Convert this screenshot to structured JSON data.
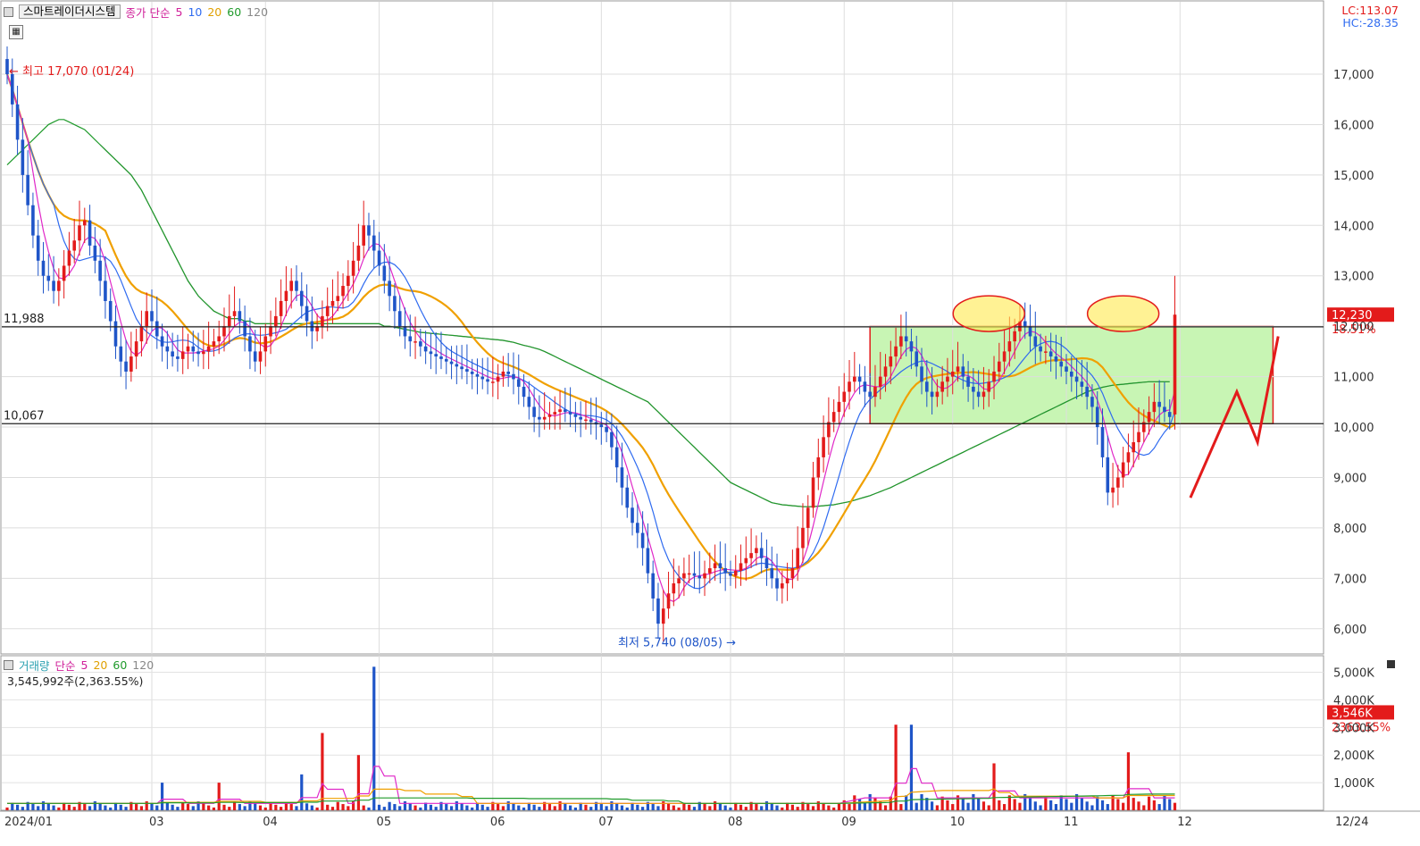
{
  "title": "스마트레이더시스템",
  "price_legend": {
    "label": "종가 단순",
    "periods": [
      "5",
      "10",
      "20",
      "60",
      "120"
    ]
  },
  "lc": "LC:113.07",
  "hc": "HC:-28.35",
  "high_annotation": "최고 17,070 (01/24)",
  "low_annotation": "최저 5,740 (08/05)",
  "levels": [
    {
      "value": 11988,
      "label": "11,988"
    },
    {
      "value": 10067,
      "label": "10,067"
    }
  ],
  "last_price": {
    "value": 12230,
    "label": "12,230",
    "change": "18.51%"
  },
  "volume_legend": {
    "label": "거래량",
    "ma_label": "단순",
    "periods": [
      "5",
      "20",
      "60",
      "120"
    ]
  },
  "volume_info": "3,545,992주(2,363.55%)",
  "last_volume": {
    "value": 3546,
    "label": "3,546K",
    "change": "2363.55%"
  },
  "colors": {
    "up": "#e31b1b",
    "down": "#1f55c8",
    "ma5": "#e028c8",
    "ma10": "#2f6bf0",
    "ma20": "#f0a000",
    "ma60": "#1e9a2a",
    "ma120": "#8a8a8a",
    "zone": "#c8f5b4"
  },
  "chart_data": [
    {
      "type": "candlestick",
      "title": "스마트레이더시스템",
      "y_ticks": [
        "6,000",
        "7,000",
        "8,000",
        "9,000",
        "10,000",
        "11,000",
        "12,000",
        "13,000",
        "14,000",
        "15,000",
        "16,000",
        "17,000"
      ],
      "ylim": [
        5500,
        18400
      ],
      "x_ticks": [
        "2024/01",
        "03",
        "04",
        "05",
        "06",
        "07",
        "08",
        "09",
        "10",
        "11",
        "12",
        "12/24"
      ],
      "x_tick_index": [
        0,
        28,
        50,
        72,
        94,
        115,
        140,
        162,
        183,
        205,
        227,
        255
      ],
      "moving_averages": [
        "5",
        "10",
        "20",
        "60",
        "120"
      ],
      "annotations": [
        "최고 17,070 (01/24)",
        "최저 5,740 (08/05)"
      ],
      "reference_lines": [
        11988,
        10067
      ],
      "box_zone": {
        "from_index": 167,
        "to_index": 245,
        "low": 10067,
        "high": 12000
      },
      "highlight_circles": [
        {
          "index": 190,
          "price": 12250
        },
        {
          "index": 216,
          "price": 12250
        }
      ],
      "drawn_arrow": [
        {
          "index": 229,
          "price": 8600
        },
        {
          "index": 238,
          "price": 10700
        },
        {
          "index": 242,
          "price": 9700
        },
        {
          "index": 246,
          "price": 11800
        }
      ],
      "close": [
        17000,
        16400,
        15700,
        15000,
        14400,
        13800,
        13300,
        13000,
        12900,
        12700,
        12900,
        13200,
        13500,
        13700,
        14000,
        14100,
        13600,
        13300,
        12900,
        12500,
        12100,
        11600,
        11300,
        11100,
        11400,
        11700,
        12000,
        12300,
        12100,
        11800,
        11600,
        11500,
        11400,
        11350,
        11500,
        11600,
        11500,
        11450,
        11500,
        11600,
        11700,
        11800,
        12000,
        12200,
        12300,
        12100,
        11800,
        11500,
        11300,
        11500,
        11800,
        12000,
        12200,
        12500,
        12700,
        12900,
        12700,
        12400,
        12100,
        11900,
        12000,
        12200,
        12400,
        12500,
        12600,
        12800,
        13000,
        13300,
        13600,
        14000,
        13800,
        13500,
        13200,
        12900,
        12600,
        12300,
        12000,
        11800,
        11700,
        11700,
        11600,
        11500,
        11450,
        11400,
        11350,
        11300,
        11250,
        11200,
        11150,
        11100,
        11050,
        11000,
        10950,
        10900,
        10900,
        11000,
        11100,
        11050,
        10950,
        10800,
        10600,
        10400,
        10200,
        10150,
        10200,
        10250,
        10300,
        10350,
        10300,
        10250,
        10200,
        10150,
        10150,
        10100,
        10050,
        10000,
        9900,
        9600,
        9200,
        8800,
        8400,
        8100,
        7900,
        7600,
        7100,
        6600,
        6100,
        6400,
        6700,
        6900,
        7000,
        7100,
        7100,
        7050,
        7000,
        7100,
        7200,
        7300,
        7200,
        7100,
        7050,
        7150,
        7300,
        7400,
        7500,
        7600,
        7400,
        7200,
        7000,
        6800,
        6900,
        7000,
        7200,
        7600,
        8000,
        8400,
        9000,
        9400,
        9800,
        10100,
        10300,
        10500,
        10700,
        10900,
        11000,
        10900,
        10700,
        10600,
        10800,
        11000,
        11200,
        11400,
        11600,
        11800,
        11700,
        11500,
        11200,
        10900,
        10700,
        10600,
        10700,
        10900,
        11000,
        11100,
        11200,
        11000,
        10800,
        10700,
        10600,
        10700,
        10900,
        11100,
        11300,
        11500,
        11700,
        11900,
        12100,
        12000,
        11800,
        11600,
        11500,
        11500,
        11400,
        11300,
        11200,
        11100,
        11000,
        10900,
        10800,
        10600,
        10400,
        10000,
        9400,
        8700,
        8800,
        9000,
        9300,
        9500,
        9700,
        9900,
        10100,
        10300,
        10500,
        10400,
        10300,
        10200,
        12230
      ],
      "ma_60": [
        15200,
        15300,
        15400,
        15500,
        15600,
        15700,
        15800,
        15900,
        16000,
        16050,
        16100,
        16100,
        16050,
        16000,
        15950,
        15900,
        15800,
        15700,
        15600,
        15500,
        15400,
        15300,
        15200,
        15100,
        15000,
        14850,
        14700,
        14500,
        14300,
        14100,
        13900,
        13700,
        13500,
        13300,
        13100,
        12900,
        12750,
        12600,
        12500,
        12400,
        12300,
        12250,
        12200,
        12150,
        12150,
        12150,
        12100,
        12100,
        12050,
        12050,
        12050,
        12050,
        12050,
        12050,
        12050,
        12050,
        12050,
        12050,
        12050,
        12050,
        12050,
        12050,
        12050,
        12050,
        12050,
        12050,
        12050,
        12050,
        12050,
        12050,
        12050,
        12050,
        12050,
        12000,
        12000,
        11980,
        11960,
        11940,
        11920,
        11900,
        11880,
        11870,
        11860,
        11850,
        11840,
        11830,
        11820,
        11810,
        11800,
        11790,
        11780,
        11770,
        11760,
        11750,
        11740,
        11730,
        11720,
        11700,
        11680,
        11650,
        11620,
        11600,
        11570,
        11540,
        11500,
        11450,
        11400,
        11350,
        11300,
        11250,
        11200,
        11150,
        11100,
        11050,
        11000,
        10950,
        10900,
        10850,
        10800,
        10750,
        10700,
        10650,
        10600,
        10550,
        10500,
        10400,
        10300,
        10200,
        10100,
        10000,
        9900,
        9800,
        9700,
        9600,
        9500,
        9400,
        9300,
        9200,
        9100,
        9000,
        8900,
        8850,
        8800,
        8750,
        8700,
        8650,
        8600,
        8550,
        8500,
        8480,
        8460,
        8450,
        8440,
        8430,
        8420,
        8420,
        8420,
        8430,
        8440,
        8450,
        8460,
        8480,
        8500,
        8520,
        8550,
        8580,
        8610,
        8640,
        8680,
        8720,
        8760,
        8800,
        8850,
        8900,
        8950,
        9000,
        9050,
        9100,
        9150,
        9200,
        9250,
        9300,
        9350,
        9400,
        9450,
        9500,
        9550,
        9600,
        9650,
        9700,
        9750,
        9800,
        9850,
        9900,
        9950,
        10000,
        10050,
        10100,
        10150,
        10200,
        10250,
        10300,
        10350,
        10400,
        10450,
        10500,
        10550,
        10600,
        10650,
        10700,
        10730,
        10760,
        10790,
        10810,
        10830,
        10840,
        10850,
        10860,
        10870,
        10880,
        10890,
        10900,
        10900,
        10900,
        10900,
        10900
      ]
    },
    {
      "type": "bar",
      "title": "거래량",
      "y_ticks": [
        "1,000K",
        "2,000K",
        "3,000K",
        "4,000K",
        "5,000K"
      ],
      "ylim": [
        0,
        5600
      ],
      "moving_averages": [
        "5",
        "20",
        "60",
        "120"
      ],
      "highlight": "3,545,992주(2,363.55%)",
      "spikes": [
        {
          "index": 30,
          "value": 1000
        },
        {
          "index": 41,
          "value": 1000
        },
        {
          "index": 57,
          "value": 1300
        },
        {
          "index": 61,
          "value": 2800
        },
        {
          "index": 68,
          "value": 2000
        },
        {
          "index": 71,
          "value": 5200
        },
        {
          "index": 172,
          "value": 3100
        },
        {
          "index": 175,
          "value": 3100
        },
        {
          "index": 191,
          "value": 1700
        },
        {
          "index": 217,
          "value": 2100
        },
        {
          "index": 246,
          "value": 3546
        }
      ],
      "base_volume_before_sep": 250,
      "base_volume_after_sep": 450
    }
  ]
}
